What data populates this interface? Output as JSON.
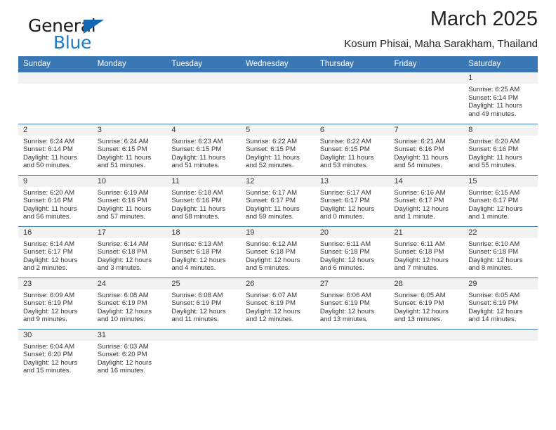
{
  "logo": {
    "word1": "General",
    "word2": "Blue",
    "triangle_color": "#1268b3",
    "word2_color": "#1f7ac4"
  },
  "header": {
    "title": "March 2025",
    "subtitle": "Kosum Phisai, Maha Sarakham, Thailand"
  },
  "theme": {
    "header_blue": "#3a78b5",
    "daynum_band": "#f2f2f2",
    "text": "#333333"
  },
  "weekdays": [
    "Sunday",
    "Monday",
    "Tuesday",
    "Wednesday",
    "Thursday",
    "Friday",
    "Saturday"
  ],
  "weeks": [
    [
      {
        "empty": true
      },
      {
        "empty": true
      },
      {
        "empty": true
      },
      {
        "empty": true
      },
      {
        "empty": true
      },
      {
        "empty": true
      },
      {
        "day": "1",
        "sunrise": "Sunrise: 6:25 AM",
        "sunset": "Sunset: 6:14 PM",
        "daylight1": "Daylight: 11 hours",
        "daylight2": "and 49 minutes."
      }
    ],
    [
      {
        "day": "2",
        "sunrise": "Sunrise: 6:24 AM",
        "sunset": "Sunset: 6:14 PM",
        "daylight1": "Daylight: 11 hours",
        "daylight2": "and 50 minutes."
      },
      {
        "day": "3",
        "sunrise": "Sunrise: 6:24 AM",
        "sunset": "Sunset: 6:15 PM",
        "daylight1": "Daylight: 11 hours",
        "daylight2": "and 51 minutes."
      },
      {
        "day": "4",
        "sunrise": "Sunrise: 6:23 AM",
        "sunset": "Sunset: 6:15 PM",
        "daylight1": "Daylight: 11 hours",
        "daylight2": "and 51 minutes."
      },
      {
        "day": "5",
        "sunrise": "Sunrise: 6:22 AM",
        "sunset": "Sunset: 6:15 PM",
        "daylight1": "Daylight: 11 hours",
        "daylight2": "and 52 minutes."
      },
      {
        "day": "6",
        "sunrise": "Sunrise: 6:22 AM",
        "sunset": "Sunset: 6:15 PM",
        "daylight1": "Daylight: 11 hours",
        "daylight2": "and 53 minutes."
      },
      {
        "day": "7",
        "sunrise": "Sunrise: 6:21 AM",
        "sunset": "Sunset: 6:16 PM",
        "daylight1": "Daylight: 11 hours",
        "daylight2": "and 54 minutes."
      },
      {
        "day": "8",
        "sunrise": "Sunrise: 6:20 AM",
        "sunset": "Sunset: 6:16 PM",
        "daylight1": "Daylight: 11 hours",
        "daylight2": "and 55 minutes."
      }
    ],
    [
      {
        "day": "9",
        "sunrise": "Sunrise: 6:20 AM",
        "sunset": "Sunset: 6:16 PM",
        "daylight1": "Daylight: 11 hours",
        "daylight2": "and 56 minutes."
      },
      {
        "day": "10",
        "sunrise": "Sunrise: 6:19 AM",
        "sunset": "Sunset: 6:16 PM",
        "daylight1": "Daylight: 11 hours",
        "daylight2": "and 57 minutes."
      },
      {
        "day": "11",
        "sunrise": "Sunrise: 6:18 AM",
        "sunset": "Sunset: 6:16 PM",
        "daylight1": "Daylight: 11 hours",
        "daylight2": "and 58 minutes."
      },
      {
        "day": "12",
        "sunrise": "Sunrise: 6:17 AM",
        "sunset": "Sunset: 6:17 PM",
        "daylight1": "Daylight: 11 hours",
        "daylight2": "and 59 minutes."
      },
      {
        "day": "13",
        "sunrise": "Sunrise: 6:17 AM",
        "sunset": "Sunset: 6:17 PM",
        "daylight1": "Daylight: 12 hours",
        "daylight2": "and 0 minutes."
      },
      {
        "day": "14",
        "sunrise": "Sunrise: 6:16 AM",
        "sunset": "Sunset: 6:17 PM",
        "daylight1": "Daylight: 12 hours",
        "daylight2": "and 1 minute."
      },
      {
        "day": "15",
        "sunrise": "Sunrise: 6:15 AM",
        "sunset": "Sunset: 6:17 PM",
        "daylight1": "Daylight: 12 hours",
        "daylight2": "and 1 minute."
      }
    ],
    [
      {
        "day": "16",
        "sunrise": "Sunrise: 6:14 AM",
        "sunset": "Sunset: 6:17 PM",
        "daylight1": "Daylight: 12 hours",
        "daylight2": "and 2 minutes."
      },
      {
        "day": "17",
        "sunrise": "Sunrise: 6:14 AM",
        "sunset": "Sunset: 6:18 PM",
        "daylight1": "Daylight: 12 hours",
        "daylight2": "and 3 minutes."
      },
      {
        "day": "18",
        "sunrise": "Sunrise: 6:13 AM",
        "sunset": "Sunset: 6:18 PM",
        "daylight1": "Daylight: 12 hours",
        "daylight2": "and 4 minutes."
      },
      {
        "day": "19",
        "sunrise": "Sunrise: 6:12 AM",
        "sunset": "Sunset: 6:18 PM",
        "daylight1": "Daylight: 12 hours",
        "daylight2": "and 5 minutes."
      },
      {
        "day": "20",
        "sunrise": "Sunrise: 6:11 AM",
        "sunset": "Sunset: 6:18 PM",
        "daylight1": "Daylight: 12 hours",
        "daylight2": "and 6 minutes."
      },
      {
        "day": "21",
        "sunrise": "Sunrise: 6:11 AM",
        "sunset": "Sunset: 6:18 PM",
        "daylight1": "Daylight: 12 hours",
        "daylight2": "and 7 minutes."
      },
      {
        "day": "22",
        "sunrise": "Sunrise: 6:10 AM",
        "sunset": "Sunset: 6:18 PM",
        "daylight1": "Daylight: 12 hours",
        "daylight2": "and 8 minutes."
      }
    ],
    [
      {
        "day": "23",
        "sunrise": "Sunrise: 6:09 AM",
        "sunset": "Sunset: 6:19 PM",
        "daylight1": "Daylight: 12 hours",
        "daylight2": "and 9 minutes."
      },
      {
        "day": "24",
        "sunrise": "Sunrise: 6:08 AM",
        "sunset": "Sunset: 6:19 PM",
        "daylight1": "Daylight: 12 hours",
        "daylight2": "and 10 minutes."
      },
      {
        "day": "25",
        "sunrise": "Sunrise: 6:08 AM",
        "sunset": "Sunset: 6:19 PM",
        "daylight1": "Daylight: 12 hours",
        "daylight2": "and 11 minutes."
      },
      {
        "day": "26",
        "sunrise": "Sunrise: 6:07 AM",
        "sunset": "Sunset: 6:19 PM",
        "daylight1": "Daylight: 12 hours",
        "daylight2": "and 12 minutes."
      },
      {
        "day": "27",
        "sunrise": "Sunrise: 6:06 AM",
        "sunset": "Sunset: 6:19 PM",
        "daylight1": "Daylight: 12 hours",
        "daylight2": "and 13 minutes."
      },
      {
        "day": "28",
        "sunrise": "Sunrise: 6:05 AM",
        "sunset": "Sunset: 6:19 PM",
        "daylight1": "Daylight: 12 hours",
        "daylight2": "and 13 minutes."
      },
      {
        "day": "29",
        "sunrise": "Sunrise: 6:05 AM",
        "sunset": "Sunset: 6:19 PM",
        "daylight1": "Daylight: 12 hours",
        "daylight2": "and 14 minutes."
      }
    ],
    [
      {
        "day": "30",
        "sunrise": "Sunrise: 6:04 AM",
        "sunset": "Sunset: 6:20 PM",
        "daylight1": "Daylight: 12 hours",
        "daylight2": "and 15 minutes."
      },
      {
        "day": "31",
        "sunrise": "Sunrise: 6:03 AM",
        "sunset": "Sunset: 6:20 PM",
        "daylight1": "Daylight: 12 hours",
        "daylight2": "and 16 minutes."
      },
      {
        "empty": true
      },
      {
        "empty": true
      },
      {
        "empty": true
      },
      {
        "empty": true
      },
      {
        "empty": true
      }
    ]
  ]
}
